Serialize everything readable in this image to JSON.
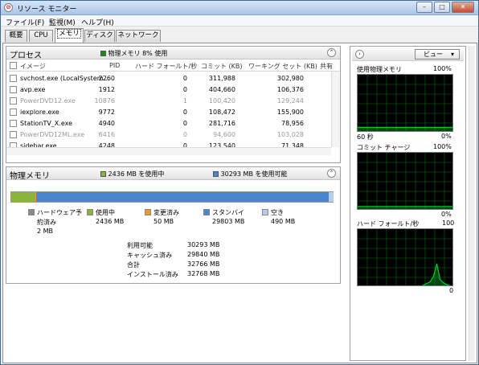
{
  "window": {
    "title": "リソース モニター",
    "minimize": "–",
    "maximize": "□",
    "close": "✕"
  },
  "menu": [
    "ファイル(F)",
    "監視(M)",
    "ヘルプ(H)"
  ],
  "tabs": [
    "概要",
    "CPU",
    "メモリ",
    "ディスク",
    "ネットワーク"
  ],
  "active_tab": "メモリ",
  "process": {
    "title": "プロセス",
    "summary": "物理メモリ 8% 使用",
    "summary_color": "#1a8a1a",
    "columns": [
      "イメージ",
      "PID",
      "ハード フォールト/秒",
      "コミット (KB)",
      "ワーキング セット (KB)",
      "共有"
    ],
    "rows": [
      {
        "name": "svchost.exe (LocalSystem...",
        "pid": "2260",
        "hf": "0",
        "commit": "311,988",
        "ws": "302,980",
        "grey": false
      },
      {
        "name": "avp.exe",
        "pid": "1912",
        "hf": "0",
        "commit": "404,660",
        "ws": "106,376",
        "grey": false
      },
      {
        "name": "PowerDVD12.exe",
        "pid": "10876",
        "hf": "1",
        "commit": "100,420",
        "ws": "129,244",
        "grey": true
      },
      {
        "name": "iexplore.exe",
        "pid": "9772",
        "hf": "0",
        "commit": "108,472",
        "ws": "155,900",
        "grey": false
      },
      {
        "name": "StationTV_X.exe",
        "pid": "4940",
        "hf": "0",
        "commit": "281,716",
        "ws": "78,956",
        "grey": false
      },
      {
        "name": "PowerDVD12ML.exe",
        "pid": "6416",
        "hf": "0",
        "commit": "94,600",
        "ws": "103,028",
        "grey": true
      },
      {
        "name": "sidebar.exe",
        "pid": "4248",
        "hf": "0",
        "commit": "123,540",
        "ws": "71,348",
        "grey": false
      }
    ]
  },
  "memory": {
    "title": "物理メモリ",
    "in_use_label": "2436 MB を使用中",
    "available_label": "30293 MB を使用可能",
    "bar": [
      {
        "key": "hardware",
        "fraction": 0.0001,
        "color": "#888888"
      },
      {
        "key": "in_use",
        "fraction": 0.0743,
        "color": "#8cb43a"
      },
      {
        "key": "modified",
        "fraction": 0.0015,
        "color": "#f09a2a"
      },
      {
        "key": "standby",
        "fraction": 0.9096,
        "color": "#4a86d0"
      },
      {
        "key": "free",
        "fraction": 0.015,
        "color": "#b7cdea"
      }
    ],
    "legend": {
      "hardware": {
        "label": "ハードウェア予約済み",
        "value": "2 MB",
        "color": "#888888"
      },
      "in_use": {
        "label": "使用中",
        "value": "2436 MB",
        "color": "#8cb43a"
      },
      "modified": {
        "label": "変更済み",
        "value": "50 MB",
        "color": "#f09a2a"
      },
      "standby": {
        "label": "スタンバイ",
        "value": "29803 MB",
        "color": "#4a86d0"
      },
      "free": {
        "label": "空き",
        "value": "490 MB",
        "color": "#b7cdea"
      }
    },
    "stats": [
      {
        "label": "利用可能",
        "value": "30293 MB"
      },
      {
        "label": "キャッシュ済み",
        "value": "29840 MB"
      },
      {
        "label": "合計",
        "value": "32766 MB"
      },
      {
        "label": "インストール済み",
        "value": "32768 MB"
      }
    ]
  },
  "right": {
    "view_button": "ビュー",
    "graphs": [
      {
        "title": "使用物理メモリ",
        "max": "100%",
        "time": "60 秒",
        "min": "0%",
        "series": [
          8,
          8,
          8,
          8,
          8,
          8,
          8,
          8,
          8,
          8,
          8,
          8,
          8,
          8,
          8,
          8,
          8,
          8,
          8,
          8,
          8,
          8,
          8,
          8,
          8,
          8,
          8,
          8,
          8,
          8
        ],
        "color": "#00cc33"
      },
      {
        "title": "コミット チャージ",
        "max": "100%",
        "time": "",
        "min": "0%",
        "series": [
          6,
          6,
          6,
          6,
          6,
          6,
          6,
          6,
          6,
          6,
          6,
          6,
          6,
          6,
          6,
          6,
          6,
          6,
          6,
          6,
          6,
          6,
          6,
          6,
          6,
          6,
          6,
          6,
          6,
          6
        ],
        "color": "#00cc33"
      },
      {
        "title": "ハード フォールト/秒",
        "max": "100",
        "time": "",
        "min": "0",
        "series": [
          0,
          0,
          0,
          0,
          0,
          0,
          0,
          0,
          0,
          0,
          0,
          0,
          0,
          0,
          0,
          0,
          0,
          0,
          0,
          0,
          2,
          5,
          8,
          18,
          40,
          12,
          6,
          3,
          1,
          0
        ],
        "color": "#00cc33"
      }
    ]
  }
}
